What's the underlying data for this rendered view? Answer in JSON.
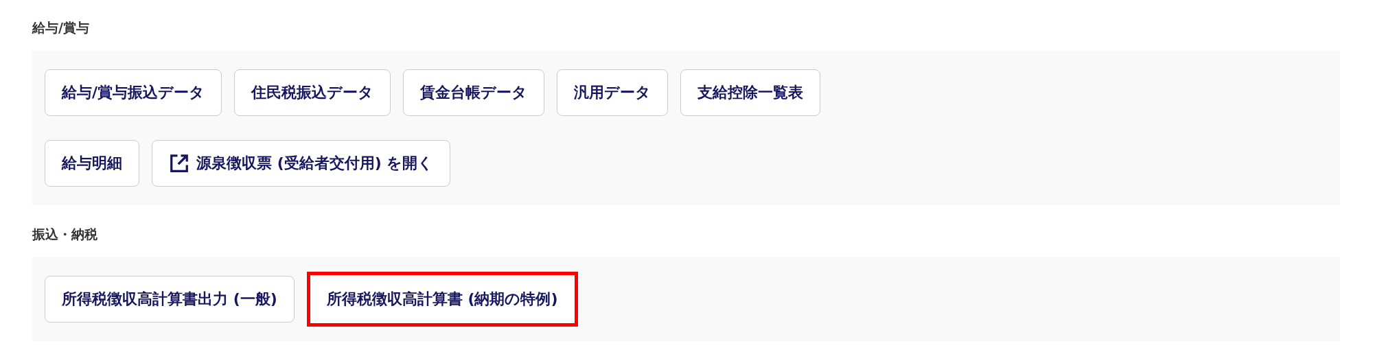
{
  "sections": [
    {
      "title": "給与/賞与",
      "rows": [
        [
          {
            "label": "給与/賞与振込データ",
            "kind": "plain",
            "highlighted": false
          },
          {
            "label": "住民税振込データ",
            "kind": "plain",
            "highlighted": false
          },
          {
            "label": "賃金台帳データ",
            "kind": "plain",
            "highlighted": false
          },
          {
            "label": "汎用データ",
            "kind": "plain",
            "highlighted": false
          },
          {
            "label": "支給控除一覧表",
            "kind": "plain",
            "highlighted": false
          }
        ],
        [
          {
            "label": "給与明細",
            "kind": "plain",
            "highlighted": false
          },
          {
            "label": "源泉徴収票 (受給者交付用) を開く",
            "kind": "external",
            "highlighted": false
          }
        ]
      ]
    },
    {
      "title": "振込・納税",
      "rows": [
        [
          {
            "label": "所得税徴収高計算書出力 (一般)",
            "kind": "plain",
            "highlighted": false
          },
          {
            "label": "所得税徴収高計算書 (納期の特例)",
            "kind": "plain",
            "highlighted": true
          }
        ]
      ]
    }
  ]
}
